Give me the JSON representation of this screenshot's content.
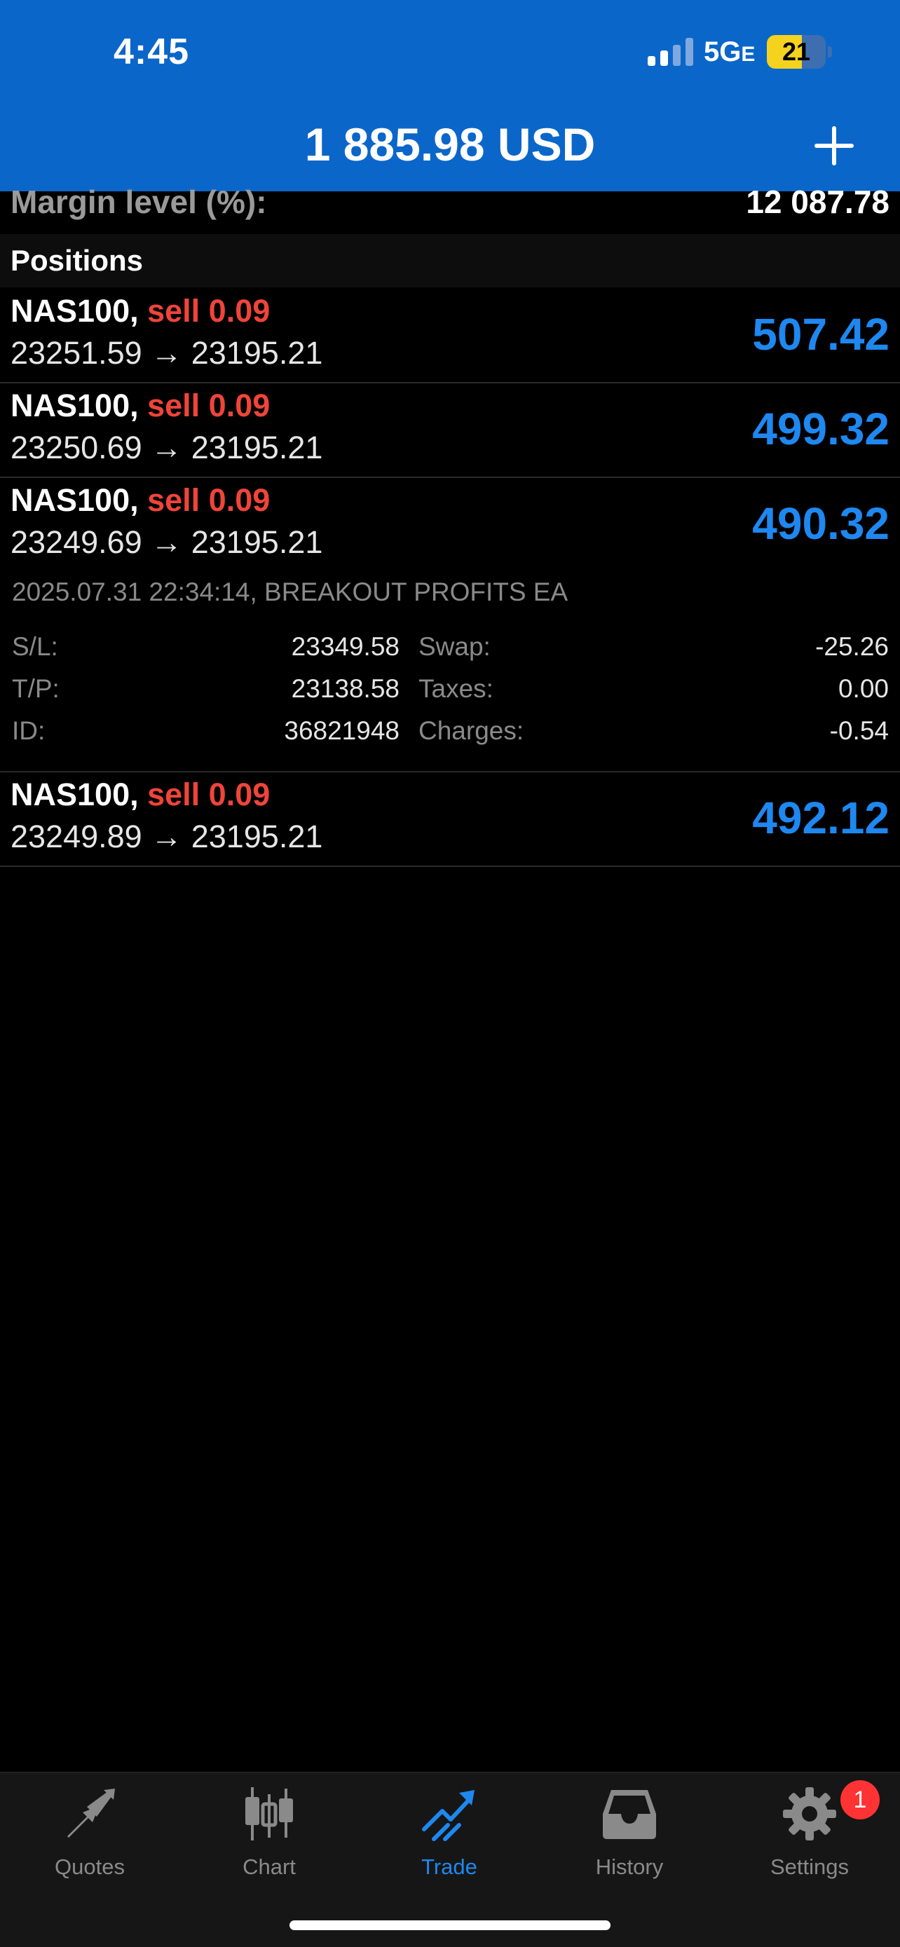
{
  "status_bar": {
    "time": "4:45",
    "network": "5G",
    "network_suffix": "E",
    "battery": "21"
  },
  "header": {
    "balance": "1 885.98 USD"
  },
  "margin_level": {
    "label": "Margin level (%):",
    "value": "12 087.78"
  },
  "positions_title": "Positions",
  "positions": [
    {
      "symbol": "NAS100,",
      "side": "sell 0.09",
      "prices": "23251.59 → 23195.21",
      "profit": "507.42"
    },
    {
      "symbol": "NAS100,",
      "side": "sell 0.09",
      "prices": "23250.69 → 23195.21",
      "profit": "499.32"
    },
    {
      "symbol": "NAS100,",
      "side": "sell 0.09",
      "prices": "23249.69 → 23195.21",
      "profit": "490.32",
      "details": {
        "comment": "2025.07.31 22:34:14, BREAKOUT PROFITS EA",
        "sl_label": "S/L:",
        "sl": "23349.58",
        "tp_label": "T/P:",
        "tp": "23138.58",
        "id_label": "ID:",
        "id": "36821948",
        "swap_label": "Swap:",
        "swap": "-25.26",
        "taxes_label": "Taxes:",
        "taxes": "0.00",
        "charges_label": "Charges:",
        "charges": "-0.54"
      }
    },
    {
      "symbol": "NAS100,",
      "side": "sell 0.09",
      "prices": "23249.89 → 23195.21",
      "profit": "492.12"
    }
  ],
  "tabs": [
    {
      "label": "Quotes",
      "icon": "quotes-icon"
    },
    {
      "label": "Chart",
      "icon": "chart-icon"
    },
    {
      "label": "Trade",
      "icon": "trade-icon"
    },
    {
      "label": "History",
      "icon": "history-icon"
    },
    {
      "label": "Settings",
      "icon": "gear-icon",
      "badge": "1"
    }
  ],
  "colors": {
    "header": "#0b66c9",
    "profit": "#1e88f0",
    "sell": "#f0443a",
    "tab_active": "#1e88f0"
  }
}
